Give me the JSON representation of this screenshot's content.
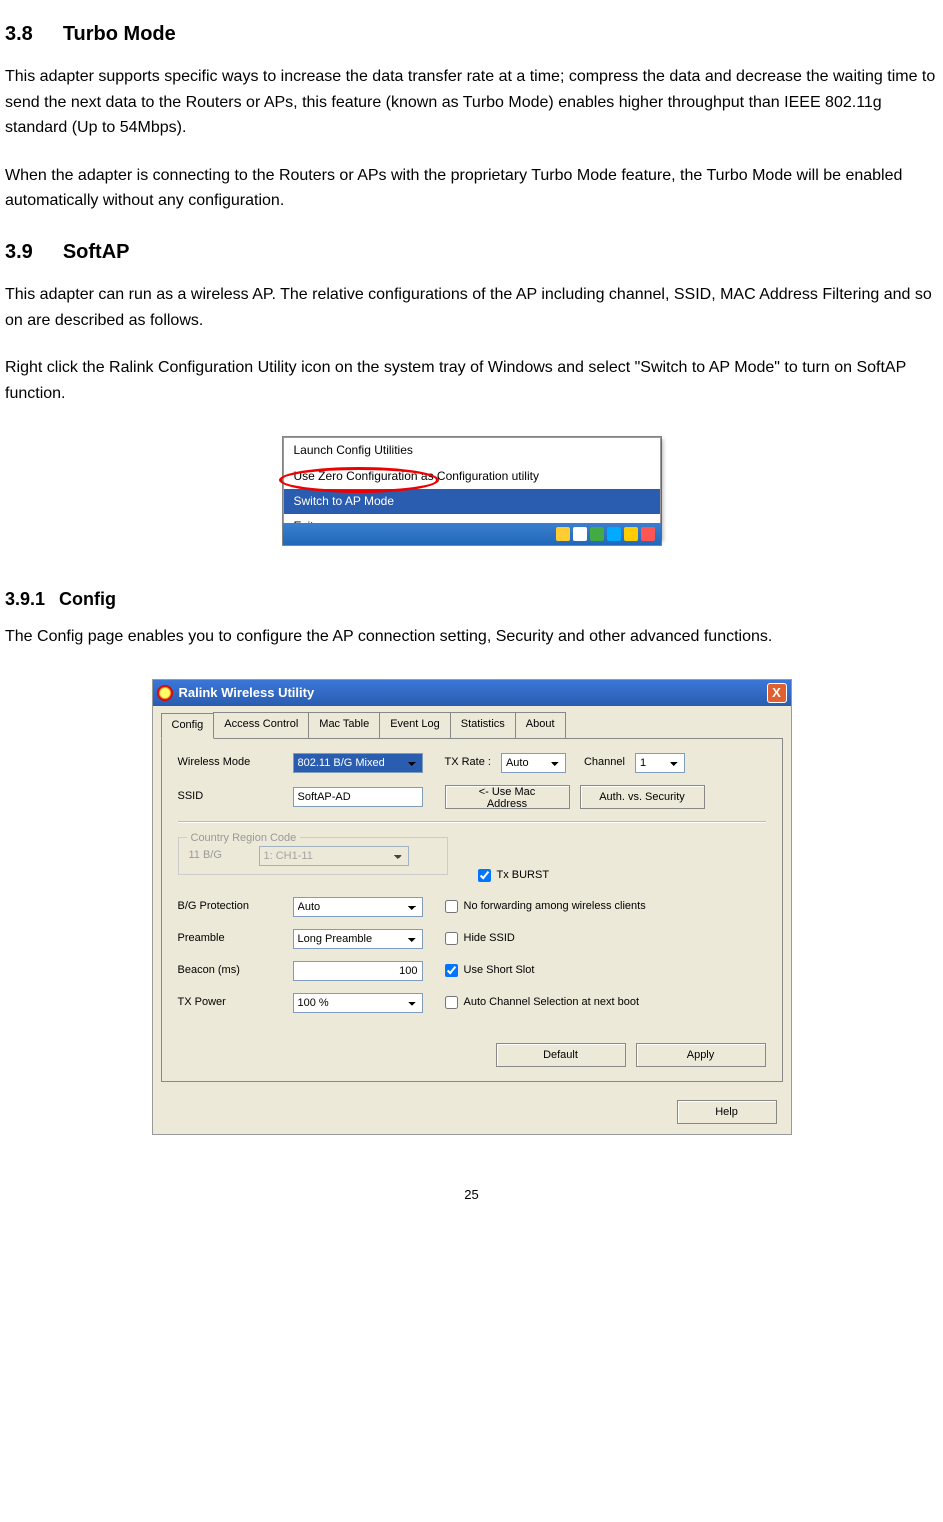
{
  "sections": {
    "s38": {
      "num": "3.8",
      "title": "Turbo Mode"
    },
    "s38_p1": "This adapter supports specific ways to increase the data transfer rate at a time; compress the data and decrease the waiting time to send the next data to the Routers or APs, this feature (known as Turbo Mode) enables higher throughput than IEEE 802.11g standard (Up to 54Mbps).",
    "s38_p2": "When the adapter is connecting to the Routers or APs with the proprietary Turbo Mode feature, the Turbo Mode will be enabled automatically without any configuration.",
    "s39": {
      "num": "3.9",
      "title": "SoftAP"
    },
    "s39_p1": "This adapter can run as a wireless AP. The relative configurations of the AP including channel, SSID, MAC Address Filtering and so on are described as follows.",
    "s39_p2": "Right click the Ralink Configuration Utility icon on the system tray of Windows and select \"Switch to AP Mode\" to turn on SoftAP function.",
    "s391": {
      "num": "3.9.1",
      "title": "Config"
    },
    "s391_p1": "The Config page enables you to configure the AP connection setting, Security and other advanced functions."
  },
  "context_menu": {
    "items": [
      "Launch Config Utilities",
      "Use Zero Configuration as Configuration utility",
      "Switch to AP Mode",
      "Exit"
    ],
    "highlighted_index": 2
  },
  "utility_window": {
    "title": "Ralink Wireless Utility",
    "close_label": "X",
    "tabs": [
      "Config",
      "Access Control",
      "Mac Table",
      "Event Log",
      "Statistics",
      "About"
    ],
    "active_tab_index": 0,
    "fields": {
      "wireless_mode": {
        "label": "Wireless Mode",
        "value": "802.11 B/G Mixed"
      },
      "tx_rate": {
        "label": "TX Rate :",
        "value": "Auto"
      },
      "channel": {
        "label": "Channel",
        "value": "1"
      },
      "ssid": {
        "label": "SSID",
        "value": "SoftAP-AD"
      },
      "use_mac_btn": "<- Use Mac Address",
      "auth_btn": "Auth. vs. Security",
      "country_legend": "Country Region Code",
      "eleven_bg": {
        "label": "11 B/G",
        "value": "1: CH1-11"
      },
      "tx_burst": {
        "label": "Tx BURST",
        "checked": true
      },
      "bg_protection": {
        "label": "B/G Protection",
        "value": "Auto"
      },
      "no_forwarding": {
        "label": "No forwarding among wireless clients",
        "checked": false
      },
      "preamble": {
        "label": "Preamble",
        "value": "Long Preamble"
      },
      "hide_ssid": {
        "label": "Hide SSID",
        "checked": false
      },
      "beacon": {
        "label": "Beacon (ms)",
        "value": "100"
      },
      "short_slot": {
        "label": "Use Short Slot",
        "checked": true
      },
      "tx_power": {
        "label": "TX Power",
        "value": "100 %"
      },
      "auto_channel": {
        "label": "Auto Channel Selection at next boot",
        "checked": false
      },
      "default_btn": "Default",
      "apply_btn": "Apply",
      "help_btn": "Help"
    }
  },
  "page_number": "25"
}
